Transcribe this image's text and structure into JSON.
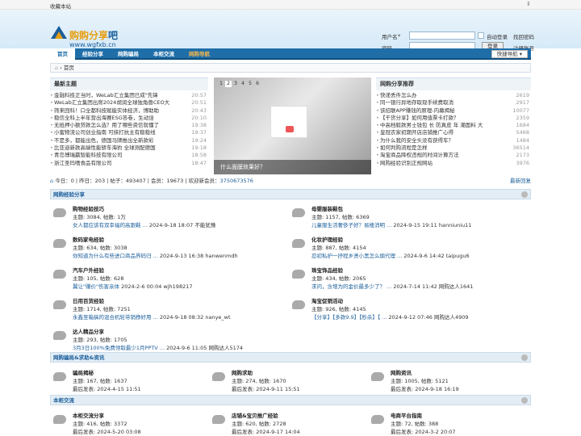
{
  "topbar": {
    "fav": "收藏本站"
  },
  "logo": {
    "name_a": "购购分享",
    "name_b": "吧",
    "url": "www.wgfxb.cn"
  },
  "login": {
    "user_label": "用户名",
    "user_opt": "▾",
    "auto": "自动登录",
    "forgot": "找回密码",
    "pass_label": "密码",
    "submit": "登录",
    "register": "注册账号"
  },
  "nav": {
    "items": [
      "首页",
      "经验分享",
      "网购骗局",
      "本柜交流",
      "网购导航"
    ],
    "quick": "快捷导航 ▾"
  },
  "crumb": "首页",
  "latest": {
    "title": "最新主题",
    "items": [
      {
        "t": "金融科技正当时，WeLab汇立集团已成\"先锋",
        "n": "20:57"
      },
      {
        "t": "WeLab汇立集团出席2024胡润全球独角兽CEO大",
        "n": "20:51"
      },
      {
        "t": "筛来回科！口全都科技赋能实体经济，博助助",
        "n": "20:43"
      },
      {
        "t": "稳信全科上半年营出海赛ESG答卷，生动诠",
        "n": "20:10"
      },
      {
        "t": "无抵押小额贷款怎么选？用了哪些资信就懂了",
        "n": "19:38"
      },
      {
        "t": "小蜜物流公司创业指南 可抹打抗主有稳稳线",
        "n": "19:37"
      },
      {
        "t": "不是多，都能出色，德国马牌推出全新款彩",
        "n": "19:24"
      },
      {
        "t": "比亚迪新款高端性能轿车海豹 全球测配德国",
        "n": "19:18"
      },
      {
        "t": "青岛博瑞赢智能科技有限公司",
        "n": "18:58"
      },
      {
        "t": "浙江圣玛嗜食品有限公司",
        "n": "18:47"
      }
    ]
  },
  "slide": {
    "pages": [
      "1",
      "2",
      "3",
      "4",
      "5",
      "6"
    ],
    "caption": "什么面膜效果好？"
  },
  "recommend": {
    "title": "网购分享推荐",
    "items": [
      {
        "t": "快递丢件怎么办",
        "n": "2619"
      },
      {
        "t": "同一银行异地存取现手续费取消",
        "n": "2917"
      },
      {
        "t": "该招联APP赚钱的原理-内幕揭秘",
        "n": "10077"
      },
      {
        "t": "【干货分享】如何用值票卡打款？",
        "n": "2359"
      },
      {
        "t": "中高档毅款男士钱包 长 防真皮 年 潮面料 大",
        "n": "1684"
      },
      {
        "t": "皇冠农家初期开店店铺推广心得",
        "n": "5468"
      },
      {
        "t": "为什么我的安全头没有获得车？",
        "n": "1484"
      },
      {
        "t": "如何判购流程是怎样",
        "n": "36514"
      },
      {
        "t": "淘宝商品降权违规的时间计算方法",
        "n": "2173"
      },
      {
        "t": "网购经验识别正规网站",
        "n": "3976"
      }
    ]
  },
  "stats": {
    "home_icon": "⌂",
    "text": "今日：0 | 昨日：203 | 帖子：493407 | 会员：19673 | 欢迎新会员：",
    "newest": "3750673576",
    "latest_link": "最新回复"
  },
  "sections": [
    {
      "title": "网购经验分享",
      "forums": [
        {
          "name": "购物经验技巧",
          "stat": "主题: 3084, 帖数: 1万",
          "last_t": "女人都应该有双幸福的高跟鞋 ...",
          "last_m": "2024-9-18 18:07 不能犹豫"
        },
        {
          "name": "母婴服装鞋包",
          "stat": "主题: 1157, 帖数: 6369",
          "last_t": "儿童服生活奢侈子好？易楼消明 ...",
          "last_m": "2024-9-15 19:11 hanniuniu11"
        },
        {
          "name": "数码家电经验",
          "stat": "主题: 634, 帖数: 3038",
          "last_t": "你知道为什么有些进口商品界码归 ...",
          "last_m": "2024-9-13 16:38 hanwenmdh"
        },
        {
          "name": "化妆护理经验",
          "stat": "主题: 887, 帖数: 4154",
          "last_t": "忍初私护一抒程乡贤小黑怎么煽代理 ...",
          "last_m": "2024-9-6 14:42 taipugu6"
        },
        {
          "name": "汽车户外经验",
          "stat": "主题: 105, 帖数: 628",
          "last_t": "翼让\"赚价\"伤害亲体",
          "last_m": "2024-2-6 00:04 wjh198217"
        },
        {
          "name": "珠宝饰品经验",
          "stat": "主题: 434, 帖数: 2065",
          "last_t": "求问，含增为的金价最多少了？ ...",
          "last_m": "2024-7-14 11:42 网购达人1641"
        },
        {
          "name": "日用百货经验",
          "stat": "主题: 1714, 帖数: 7251",
          "last_t": "永鑫至箱搞的混合机轮带销挣好用 ...",
          "last_m": "2024-9-18 08:32 nanye_wt"
        },
        {
          "name": "淘宝促销活动",
          "stat": "主题: 926, 帖数: 4145",
          "last_t": "【分享】【多款9.9】【秒杀】【 ...",
          "last_m": "2024-9-12 07:46 网购达人4909"
        },
        {
          "name": "达人精品分享",
          "stat": "主题: 293, 帖数: 1705",
          "last_t": "3月3日100%免费领取最少1月PPTV ...",
          "last_m": "2024-9-6 11:05 网购达人5174"
        }
      ]
    },
    {
      "title": "网购骗局&求助&资讯",
      "forums": [
        {
          "name": "骗局揭秘",
          "stat": "主题: 167, 帖数: 1637",
          "last_t": "",
          "last_m": "最后发表: 2024-4-15 11:51"
        },
        {
          "name": "网购求助",
          "stat": "主题: 274, 帖数: 1670",
          "last_t": "",
          "last_m": "最后发表: 2024-9-11 15:51"
        },
        {
          "name": "网购资讯",
          "stat": "主题: 1005, 帖数: 5121",
          "last_t": "",
          "last_m": "最后发表: 2024-9-18 16:19"
        }
      ]
    },
    {
      "title": "本柜交流",
      "forums": [
        {
          "name": "本柜交流分享",
          "stat": "主题: 416, 帖数: 3372",
          "last_t": "",
          "last_m": "最后发表: 2024-5-20 03:08"
        },
        {
          "name": "店铺&宝贝推广经验",
          "stat": "主题: 620, 帖数: 2728",
          "last_t": "",
          "last_m": "最后发表: 2024-9-17 14:04"
        },
        {
          "name": "电商平台指南",
          "stat": "主题: 72, 帖数: 388",
          "last_t": "",
          "last_m": "最后发表: 2024-3-2 20:07"
        }
      ]
    }
  ]
}
